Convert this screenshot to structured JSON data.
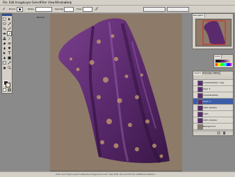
{
  "menu": {
    "items": [
      "File",
      "Edit",
      "Image",
      "Layer",
      "Select",
      "Filter",
      "View",
      "Window",
      "Help"
    ]
  },
  "options_bar": {
    "brush_label": "Brush:",
    "mode_label": "Mode:",
    "mode_value": "Normal",
    "opacity_label": "Opacity:",
    "opacity_value": "100%",
    "flow_label": "Flow:",
    "flow_value": "100%"
  },
  "colors": {
    "foreground": "#2a1a2e",
    "background": "#f4e2c4",
    "canvas": "#8d7a68",
    "cloth": "#5b2a6e",
    "highlight": "#3b5ea6"
  },
  "navigator": {
    "title": "Navigator"
  },
  "color_panel": {
    "title": "Color"
  },
  "layers_panel": {
    "tabs": [
      "Layers",
      "Channels",
      "Paths"
    ],
    "layers": [
      {
        "name": "ornamentation copy",
        "selected": false
      },
      {
        "name": "layer 3",
        "selected": false
      },
      {
        "name": "ornamentation",
        "selected": false
      },
      {
        "name": "Layer 1",
        "selected": true
      },
      {
        "name": "cloth shadow",
        "selected": false
      },
      {
        "name": "cloth",
        "selected": false
      },
      {
        "name": "cloth shadow",
        "selected": false
      },
      {
        "name": "Background",
        "selected": false
      }
    ]
  },
  "status": {
    "text": "Click and drag to paint using the foreground color. Use Shift, Alt, and Ctrl for additional options."
  }
}
